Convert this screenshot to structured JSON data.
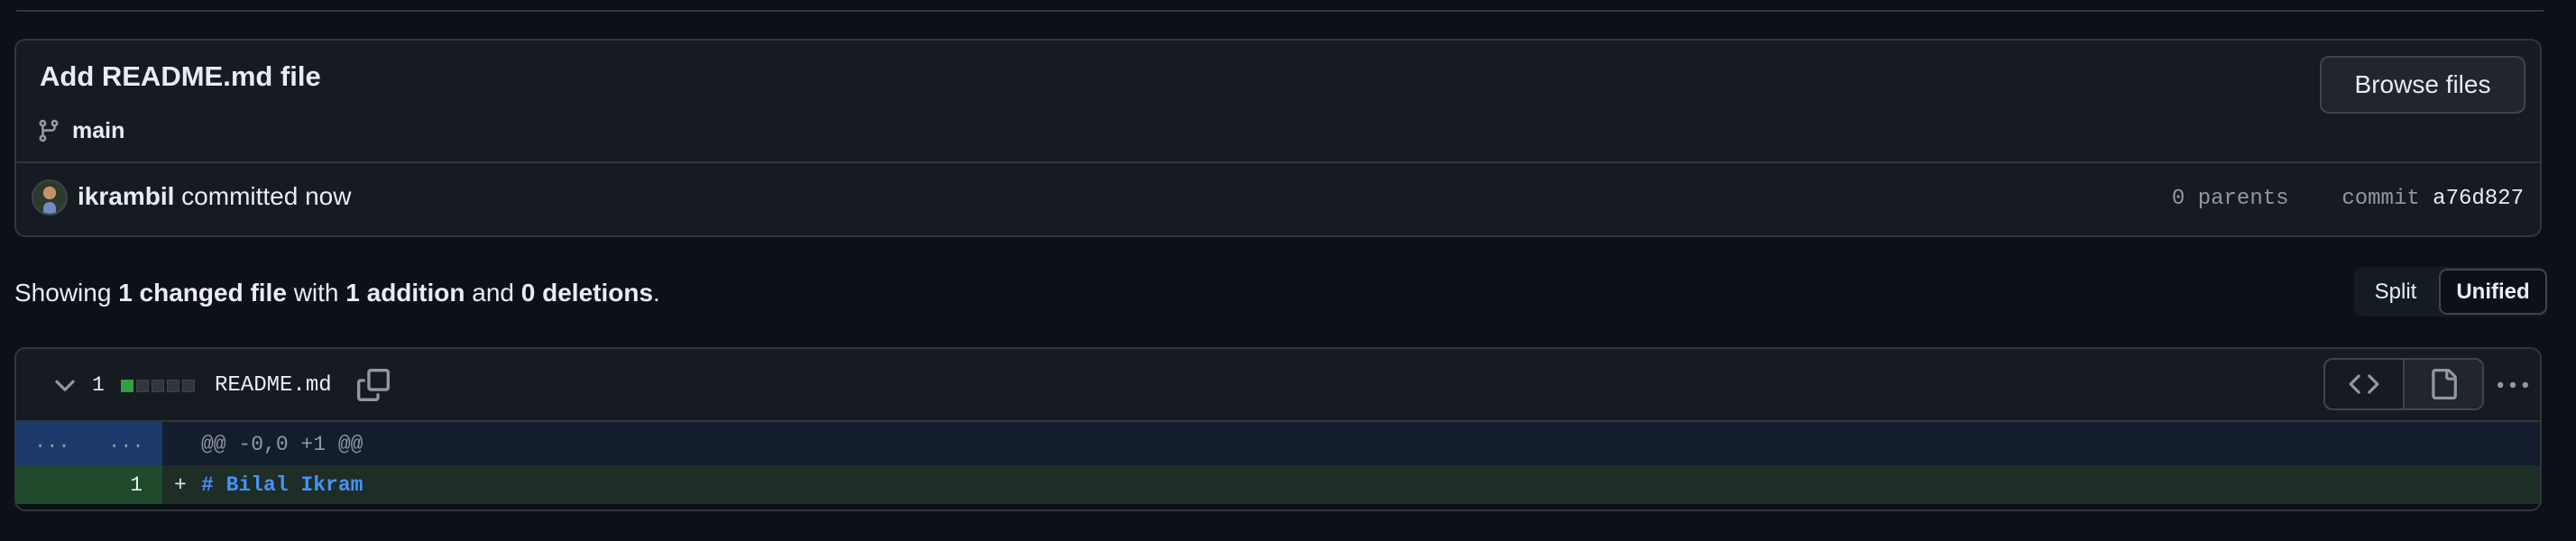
{
  "commit": {
    "title": "Add README.md file",
    "branch": "main",
    "browse_label": "Browse files",
    "author": "ikrambil",
    "action_text": "committed now",
    "parents": "0 parents",
    "commit_label": "commit",
    "hash": "a76d827"
  },
  "summary": {
    "prefix": "Showing",
    "changed": "1 changed file",
    "with": "with",
    "additions": "1 addition",
    "and": "and",
    "deletions": "0 deletions",
    "end": "."
  },
  "view_modes": {
    "split": "Split",
    "unified": "Unified",
    "selected": "Unified"
  },
  "file": {
    "change_count": "1",
    "filename": "README.md",
    "diffstat": {
      "added_blocks": 1,
      "neutral_blocks": 4
    },
    "hunk": {
      "left_dots": "...",
      "right_dots": "...",
      "header": "@@ -0,0 +1 @@"
    },
    "lines": [
      {
        "number": "1",
        "marker": "+",
        "code": "# Bilal Ikram"
      }
    ]
  },
  "icons": {
    "branch": "git-branch-icon",
    "collapse": "chevron-down-icon",
    "copy": "copy-icon",
    "source": "code-icon",
    "rich": "file-icon",
    "more": "kebab-horizontal-icon"
  },
  "colors": {
    "page_bg": "#0d1117",
    "panel_bg": "#161b22",
    "border": "#30363d",
    "text": "#e6edf3",
    "muted": "#9198a1",
    "accent_blue": "#4493f8",
    "hunk_bg": "#131d2e",
    "addition_bg": "#1e2d26",
    "addition_gutter": "#1f4a2b",
    "diffstat_add": "#2ea043"
  }
}
